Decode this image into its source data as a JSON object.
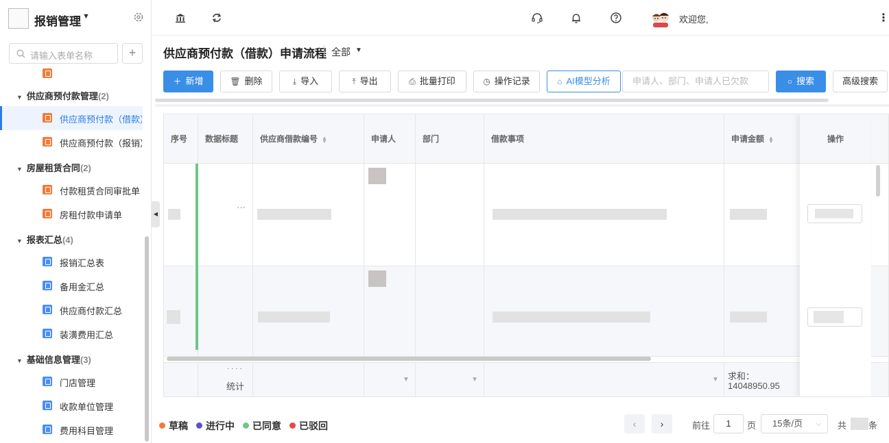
{
  "app": {
    "title": "报销管理"
  },
  "sidebar": {
    "search_placeholder": "请输入表单名称",
    "add_label": "+",
    "groups": [
      {
        "name": "供应商预付款管理",
        "count": "(2)"
      },
      {
        "name": "房屋租赁合同",
        "count": "(2)"
      },
      {
        "name": "报表汇总",
        "count": "(4)"
      },
      {
        "name": "基础信息管理",
        "count": "(3)"
      }
    ],
    "items": [
      {
        "label": "供应商预付款（借款）申请流程",
        "icon": "form-icon",
        "color": "#f07c3a",
        "active": true
      },
      {
        "label": "供应商预付款（报销）",
        "icon": "form-icon",
        "color": "#f07c3a"
      },
      {
        "label": "付款租赁合同审批单",
        "icon": "form-icon",
        "color": "#f07c3a"
      },
      {
        "label": "房租付款申请单",
        "icon": "form-icon",
        "color": "#f07c3a"
      },
      {
        "label": "报销汇总表",
        "icon": "report-icon",
        "color": "#4a8ef0"
      },
      {
        "label": "备用金汇总",
        "icon": "report-icon",
        "color": "#4a8ef0"
      },
      {
        "label": "供应商付款汇总",
        "icon": "report-icon",
        "color": "#4a8ef0"
      },
      {
        "label": "装潢费用汇总",
        "icon": "report-icon",
        "color": "#4a8ef0"
      },
      {
        "label": "门店管理",
        "icon": "report-icon",
        "color": "#4a8ef0"
      },
      {
        "label": "收款单位管理",
        "icon": "report-icon",
        "color": "#4a8ef0"
      },
      {
        "label": "费用科目管理",
        "icon": "report-icon",
        "color": "#4a8ef0"
      }
    ]
  },
  "header": {
    "welcome": "欢迎您,",
    "icons": [
      "bank-icon",
      "refresh-icon",
      "headset-icon",
      "bell-icon",
      "help-icon",
      "avatar",
      "more-icon"
    ]
  },
  "page": {
    "title": "供应商预付款（借款）申请流程",
    "filter": "全部"
  },
  "toolbar": {
    "new_label": "新增",
    "delete_label": "删除",
    "import_label": "导入",
    "export_label": "导出",
    "print_label": "批量打印",
    "log_label": "操作记录",
    "ai_label": "AI模型分析",
    "search_placeholder": "申请人、部门、申请人已欠款",
    "search_label": "搜索",
    "advanced_label": "高级搜索"
  },
  "table": {
    "columns": [
      "序号",
      "数据标题",
      "供应商借款编号",
      "申请人",
      "部门",
      "借款事项",
      "申请金额",
      "操作"
    ],
    "row1_title": "···",
    "footer": {
      "dots": "· · · ·",
      "label": "统计",
      "sum_label": "求和：",
      "sum_value": "14048950.95"
    }
  },
  "legend": [
    {
      "label": "草稿",
      "color": "#f07c3a"
    },
    {
      "label": "进行中",
      "color": "#5b4fcf"
    },
    {
      "label": "已同意",
      "color": "#6cc788"
    },
    {
      "label": "已驳回",
      "color": "#e8474c"
    }
  ],
  "pagination": {
    "goto_label": "前往",
    "page": "1",
    "page_unit": "页",
    "page_size": "15条/页",
    "total_prefix": "共",
    "total_suffix": "条"
  }
}
